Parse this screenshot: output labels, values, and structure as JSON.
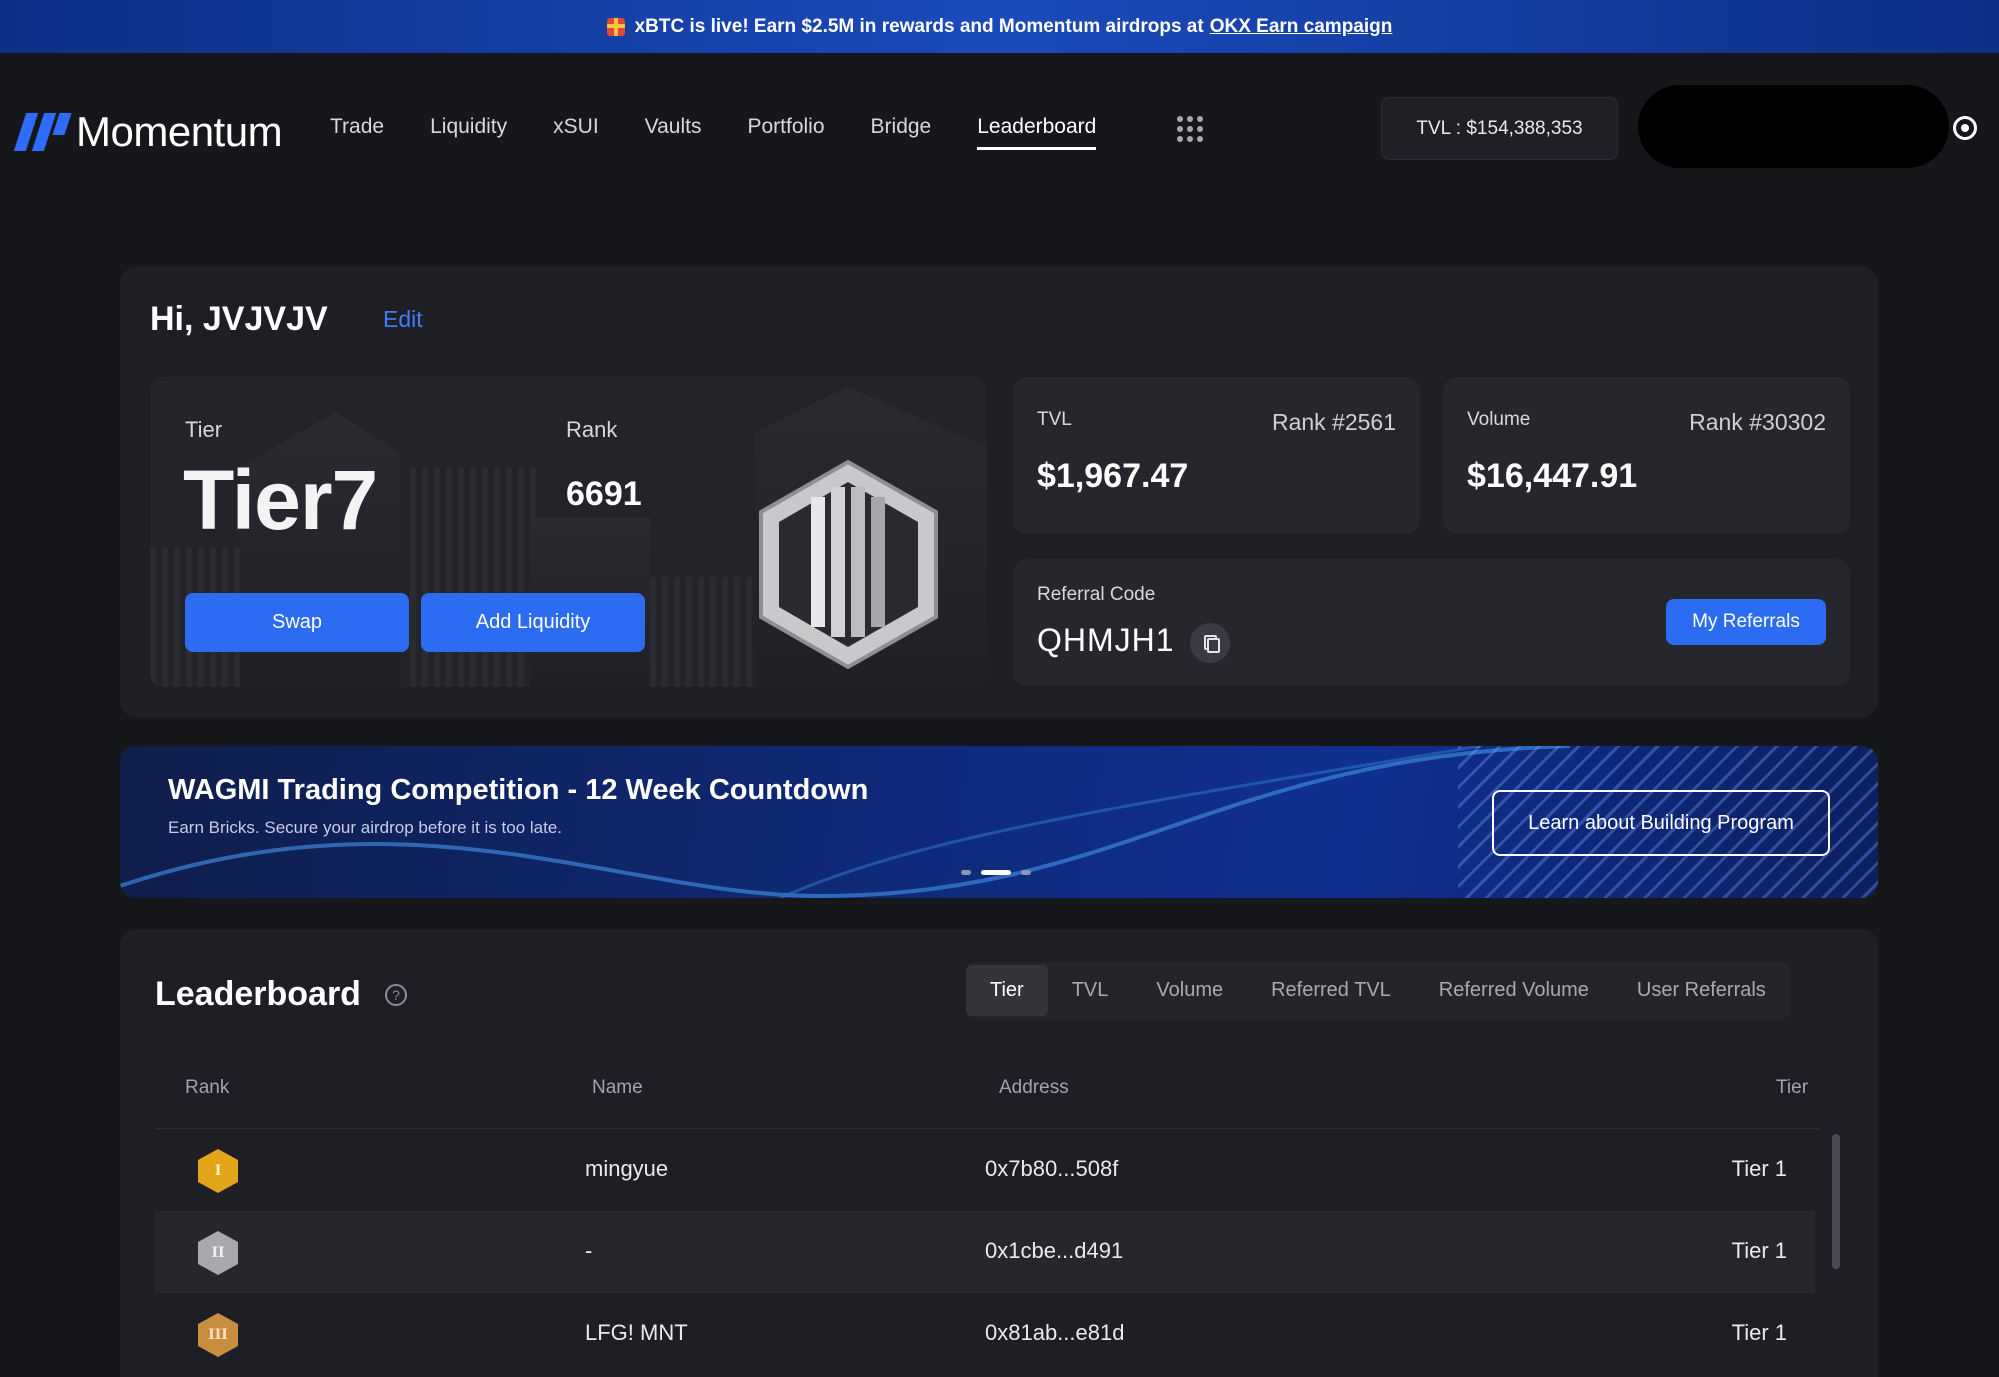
{
  "banner": {
    "text": "xBTC is live! Earn $2.5M in rewards and Momentum airdrops at",
    "link": "OKX Earn campaign"
  },
  "nav": {
    "brand": "Momentum",
    "links": [
      "Trade",
      "Liquidity",
      "xSUI",
      "Vaults",
      "Portfolio",
      "Bridge",
      "Leaderboard"
    ],
    "active": "Leaderboard",
    "tvl": "TVL : $154,388,353"
  },
  "profile": {
    "greeting": "Hi, JVJVJV",
    "edit": "Edit",
    "tier_label": "Tier",
    "tier_value": "Tier7",
    "rank_label": "Rank",
    "rank_value": "6691",
    "swap": "Swap",
    "add_liquidity": "Add Liquidity",
    "tvl": {
      "label": "TVL",
      "rank": "Rank  #2561",
      "value": "$1,967.47"
    },
    "volume": {
      "label": "Volume",
      "rank": "Rank  #30302",
      "value": "$16,447.91"
    },
    "referral": {
      "label": "Referral Code",
      "code": "QHMJH1",
      "button": "My Referrals"
    }
  },
  "promo": {
    "title": "WAGMI Trading Competition - 12 Week Countdown",
    "subtitle": "Earn Bricks. Secure your airdrop before it is too late.",
    "button": "Learn about Building Program",
    "active_slide": 2
  },
  "leaderboard": {
    "title": "Leaderboard",
    "tabs": [
      "Tier",
      "TVL",
      "Volume",
      "Referred TVL",
      "Referred Volume",
      "User Referrals"
    ],
    "active_tab": "Tier",
    "columns": [
      "Rank",
      "Name",
      "Address",
      "Tier"
    ],
    "rows": [
      {
        "medal": "I",
        "name": "mingyue",
        "address": "0x7b80...508f",
        "tier": "Tier 1"
      },
      {
        "medal": "II",
        "name": "-",
        "address": "0x1cbe...d491",
        "tier": "Tier 1"
      },
      {
        "medal": "III",
        "name": "LFG! MNT",
        "address": "0x81ab...e81d",
        "tier": "Tier 1"
      }
    ]
  },
  "colors": {
    "accent": "#2c6cf2",
    "background": "#16171b",
    "card": "#1e1f24"
  }
}
